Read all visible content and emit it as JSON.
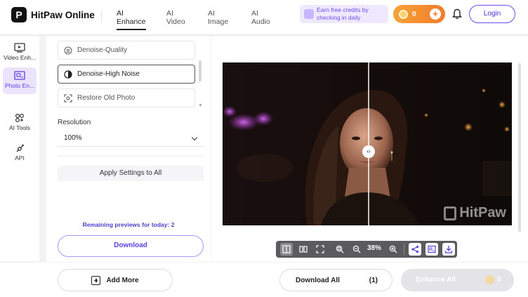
{
  "app": {
    "name": "HitPaw Online",
    "logo_letter": "P"
  },
  "topnav": {
    "tabs": [
      {
        "line1": "AI",
        "line2": "Enhance",
        "active": true
      },
      {
        "line1": "AI",
        "line2": "Video",
        "active": false
      },
      {
        "line1": "AI",
        "line2": "Image",
        "active": false
      },
      {
        "line1": "AI",
        "line2": "Audio",
        "active": false
      }
    ]
  },
  "promo": {
    "line1": "Earn free credits by",
    "line2": "checking in daily"
  },
  "credits": {
    "count": "0",
    "plus": "+"
  },
  "login": {
    "label": "Login"
  },
  "rail": {
    "items": [
      {
        "label": "Video Enh...",
        "icon": "video-enhance-icon",
        "active": false
      },
      {
        "label": "Photo En...",
        "icon": "photo-enhance-icon",
        "active": true
      },
      {
        "label": "AI Tools",
        "icon": "ai-tools-icon",
        "active": false
      },
      {
        "label": "API",
        "icon": "api-icon",
        "active": false
      }
    ]
  },
  "panel": {
    "models": [
      {
        "label": "Denoise-Quality",
        "icon": "denoise-quality-icon",
        "selected": false
      },
      {
        "label": "Denoise-High Noise",
        "icon": "denoise-high-noise-icon",
        "selected": true
      },
      {
        "label": "Restore Old Photo",
        "icon": "restore-old-photo-icon",
        "selected": false
      }
    ],
    "resolution_label": "Resolution",
    "resolution_value": "100%",
    "apply_label": "Apply Settings to All",
    "remaining_text": "Remaining previews for today: 2",
    "download_label": "Download"
  },
  "preview": {
    "handle": "‹›",
    "watermark": "HitPaw",
    "zoom": "38%"
  },
  "bottom": {
    "add_more": "Add More",
    "download_all": "Download All",
    "download_count": "(1)",
    "enhance_all": "Enhance All",
    "enhance_cost": "0"
  },
  "colors": {
    "accent": "#6c4cf0",
    "credits": "#f27b2a"
  }
}
